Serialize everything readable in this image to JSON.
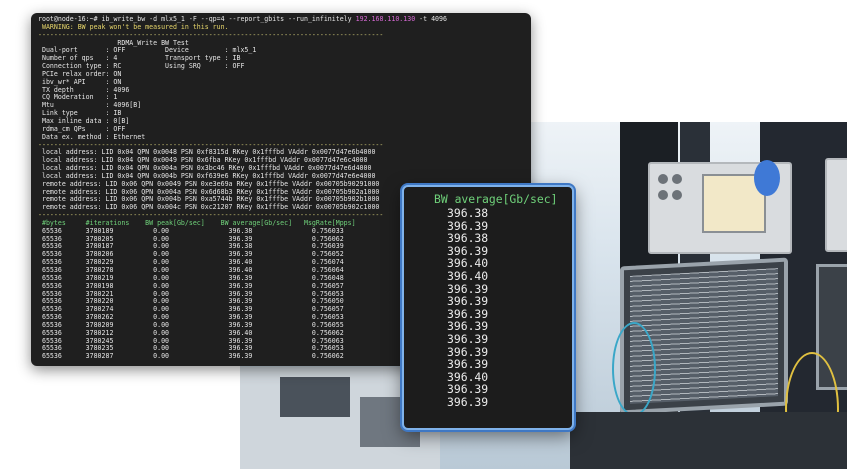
{
  "terminal": {
    "prompt": "root@node-16:~#",
    "command": "ib_write_bw -d mlx5_1 -F --qp=4 --report_gbits --run_infinitely",
    "ip": "192.168.110.130",
    "command_tail": "-t 4096",
    "warning": " WARNING: BW peak won't be measured in this run.",
    "dashes": "---------------------------------------------------------------------------------------",
    "test_title": "                    RDMA_Write BW Test",
    "config_lines": [
      " Dual-port       : OFF          Device         : mlx5_1",
      " Number of qps   : 4            Transport type : IB",
      " Connection type : RC           Using SRQ      : OFF",
      " PCIe relax order: ON",
      " ibv_wr* API     : ON",
      " TX depth        : 4096",
      " CQ Moderation   : 1",
      " Mtu             : 4096[B]",
      " Link type       : IB",
      " Max inline data : 0[B]",
      " rdma_cm QPs     : OFF",
      " Data ex. method : Ethernet"
    ],
    "address_lines": [
      " local address: LID 0x04 QPN 0x0048 PSN 0xf8315d RKey 0x1fffbd VAddr 0x0077d47e6b4000",
      " local address: LID 0x04 QPN 0x0049 PSN 0x6fba RKey 0x1fffbd VAddr 0x0077d47e6c4000",
      " local address: LID 0x04 QPN 0x004a PSN 0x3bc46 RKey 0x1fffbd VAddr 0x0077d47e6d4000",
      " local address: LID 0x04 QPN 0x004b PSN 0xf639e6 RKey 0x1fffbd VAddr 0x0077d47e6e4000",
      " remote address: LID 0x06 QPN 0x0049 PSN 0xe3e69a RKey 0x1fffbe VAddr 0x00705b90291000",
      " remote address: LID 0x06 QPN 0x004a PSN 0x6d68b3 RKey 0x1fffbe VAddr 0x00705b902a1000",
      " remote address: LID 0x06 QPN 0x004b PSN 0xa5744b RKey 0x1fffbe VAddr 0x00705b902b1000",
      " remote address: LID 0x06 QPN 0x004c PSN 0xc21207 RKey 0x1fffbe VAddr 0x00705b902c1000"
    ],
    "table_header": " #bytes     #iterations    BW peak[Gb/sec]    BW average[Gb/sec]   MsgRate[Mpps]",
    "table_rows": [
      " 65536      3780189          0.00               396.38               0.756033",
      " 65536      3780205          0.00               396.39               0.756062",
      " 65536      3780187          0.00               396.38               0.756039",
      " 65536      3780206          0.00               396.39               0.756052",
      " 65536      3780229          0.00               396.40               0.756074",
      " 65536      3780278          0.00               396.40               0.756064",
      " 65536      3780219          0.00               396.39               0.756048",
      " 65536      3780198          0.00               396.39               0.756057",
      " 65536      3780221          0.00               396.39               0.756053",
      " 65536      3780220          0.00               396.39               0.756050",
      " 65536      3780274          0.00               396.39               0.756057",
      " 65536      3780262          0.00               396.39               0.756053",
      " 65536      3780209          0.00               396.39               0.756055",
      " 65536      3780212          0.00               396.40               0.756062",
      " 65536      3780245          0.00               396.39               0.756063",
      " 65536      3780235          0.00               396.39               0.756053",
      " 65536      3780287          0.00               396.39               0.756062"
    ]
  },
  "zoom_panel": {
    "header": "BW average[Gb/sec]",
    "values": [
      "396.38",
      "396.39",
      "396.38",
      "396.39",
      "396.40",
      "396.40",
      "396.39",
      "396.39",
      "396.39",
      "396.39",
      "396.39",
      "396.39",
      "396.39",
      "396.40",
      "396.39",
      "396.39"
    ]
  },
  "colors": {
    "terminal_bg": "#1f1f1f",
    "prompt_ip": "#d86ad6",
    "warning": "#e6d56a",
    "table_header": "#6fd17a",
    "zoom_border": "#7fb2ea"
  }
}
